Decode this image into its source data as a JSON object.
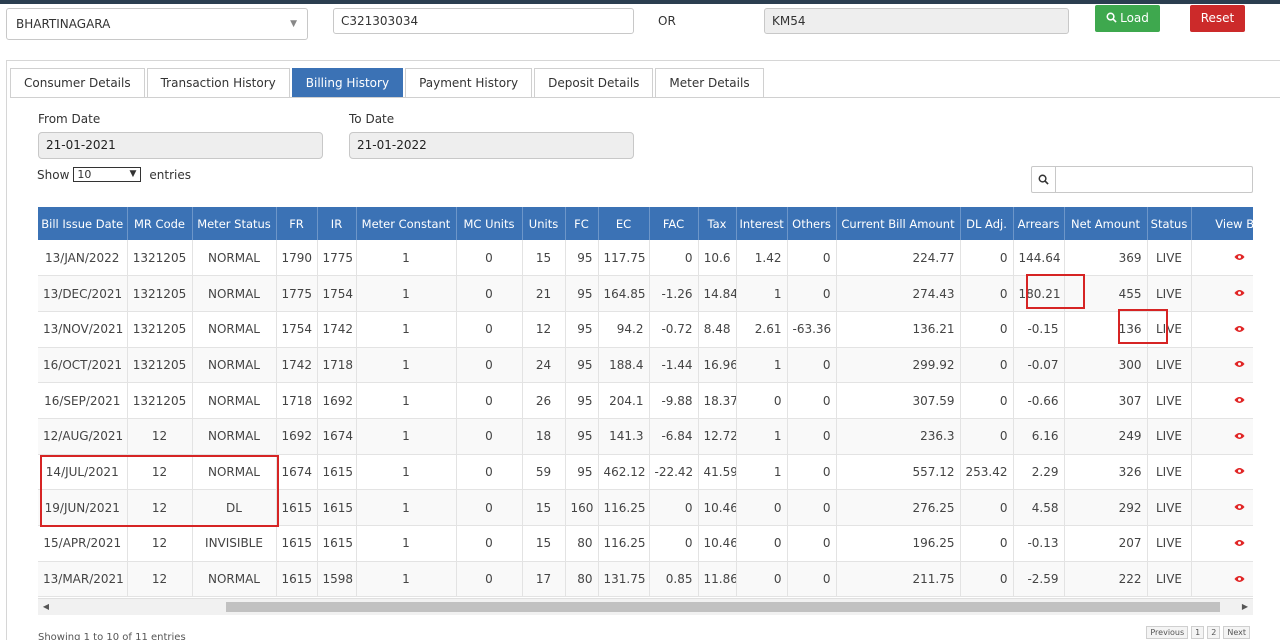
{
  "top": {
    "area_select_value": "BHARTINAGARA",
    "consumer_no": "C321303034",
    "or_label": "OR",
    "km_value": "KM54",
    "load_label": "Load",
    "reset_label": "Reset"
  },
  "tabs": [
    {
      "label": "Consumer Details"
    },
    {
      "label": "Transaction History"
    },
    {
      "label": "Billing History"
    },
    {
      "label": "Payment History"
    },
    {
      "label": "Deposit Details"
    },
    {
      "label": "Meter Details"
    }
  ],
  "filters": {
    "from_label": "From Date",
    "from_value": "21-01-2021",
    "to_label": "To Date",
    "to_value": "21-01-2022",
    "show_label": "Show",
    "entries_value": "10",
    "entries_label": "entries"
  },
  "table": {
    "columns": [
      "Bill Issue Date",
      "MR Code",
      "Meter Status",
      "FR",
      "IR",
      "Meter Constant",
      "MC Units",
      "Units",
      "FC",
      "EC",
      "FAC",
      "Tax",
      "Interest",
      "Others",
      "Current Bill Amount",
      "DL Adj.",
      "Arrears",
      "Net Amount",
      "Status",
      "View Bill"
    ],
    "rows": [
      [
        "13/JAN/2022",
        "1321205",
        "NORMAL",
        "1790",
        "1775",
        "1",
        "0",
        "15",
        "95",
        "117.75",
        "0",
        "10.6",
        "1.42",
        "0",
        "224.77",
        "0",
        "144.64",
        "369",
        "LIVE"
      ],
      [
        "13/DEC/2021",
        "1321205",
        "NORMAL",
        "1775",
        "1754",
        "1",
        "0",
        "21",
        "95",
        "164.85",
        "-1.26",
        "14.84",
        "1",
        "0",
        "274.43",
        "0",
        "180.21",
        "455",
        "LIVE"
      ],
      [
        "13/NOV/2021",
        "1321205",
        "NORMAL",
        "1754",
        "1742",
        "1",
        "0",
        "12",
        "95",
        "94.2",
        "-0.72",
        "8.48",
        "2.61",
        "-63.36",
        "136.21",
        "0",
        "-0.15",
        "136",
        "LIVE"
      ],
      [
        "16/OCT/2021",
        "1321205",
        "NORMAL",
        "1742",
        "1718",
        "1",
        "0",
        "24",
        "95",
        "188.4",
        "-1.44",
        "16.96",
        "1",
        "0",
        "299.92",
        "0",
        "-0.07",
        "300",
        "LIVE"
      ],
      [
        "16/SEP/2021",
        "1321205",
        "NORMAL",
        "1718",
        "1692",
        "1",
        "0",
        "26",
        "95",
        "204.1",
        "-9.88",
        "18.37",
        "0",
        "0",
        "307.59",
        "0",
        "-0.66",
        "307",
        "LIVE"
      ],
      [
        "12/AUG/2021",
        "12",
        "NORMAL",
        "1692",
        "1674",
        "1",
        "0",
        "18",
        "95",
        "141.3",
        "-6.84",
        "12.72",
        "1",
        "0",
        "236.3",
        "0",
        "6.16",
        "249",
        "LIVE"
      ],
      [
        "14/JUL/2021",
        "12",
        "NORMAL",
        "1674",
        "1615",
        "1",
        "0",
        "59",
        "95",
        "462.12",
        "-22.42",
        "41.59",
        "1",
        "0",
        "557.12",
        "253.42",
        "2.29",
        "326",
        "LIVE"
      ],
      [
        "19/JUN/2021",
        "12",
        "DL",
        "1615",
        "1615",
        "1",
        "0",
        "15",
        "160",
        "116.25",
        "0",
        "10.46",
        "0",
        "0",
        "276.25",
        "0",
        "4.58",
        "292",
        "LIVE"
      ],
      [
        "15/APR/2021",
        "12",
        "INVISIBLE",
        "1615",
        "1615",
        "1",
        "0",
        "15",
        "80",
        "116.25",
        "0",
        "10.46",
        "0",
        "0",
        "196.25",
        "0",
        "-0.13",
        "207",
        "LIVE"
      ],
      [
        "13/MAR/2021",
        "12",
        "NORMAL",
        "1615",
        "1598",
        "1",
        "0",
        "17",
        "80",
        "131.75",
        "0.85",
        "11.86",
        "0",
        "0",
        "211.75",
        "0",
        "-2.59",
        "222",
        "LIVE"
      ]
    ]
  },
  "pagination": {
    "previous": "Previous",
    "page1": "1",
    "page2": "2",
    "next": "Next"
  },
  "info": "Showing 1 to 10 of 11 entries",
  "icons": {
    "view": "eye-icon",
    "search": "search-icon",
    "load": "search-icon"
  },
  "colors": {
    "accent": "#3b72b5",
    "load": "#3ea84e",
    "reset": "#cc2a2a",
    "highlight": "#d62424"
  }
}
